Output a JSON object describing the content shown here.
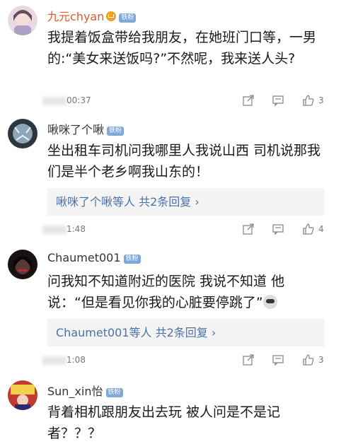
{
  "comments": [
    {
      "username": "九元chyan",
      "badge": "铁粉",
      "content": "我提着饭盒带给我朋友，在她班门口等，一男的:“美女来送饭吗?”不然呢，我来送人头?",
      "time": "00:37",
      "likes": "3"
    },
    {
      "username": "啾咪了个啾",
      "badge": "铁粉",
      "content": "坐出租车司机问我哪里人我说山西 司机说那我们是半个老乡啊我山东的！",
      "reply_summary": "啾咪了个啾等人  共2条回复 ›",
      "time": "1:48",
      "likes": "4"
    },
    {
      "username": "Chaumet001",
      "badge": "铁粉",
      "content": "问我知不知道附近的医院 我说不知道 他说：“但是看见你我的心脏要停跳了”",
      "reply_summary": "Chaumet001等人 共2条回复 ›",
      "time": "1:08",
      "likes": "3"
    },
    {
      "username": "Sun_xin怡",
      "badge": "铁粉",
      "content": "背着相机跟朋友出去玩 被人问是不是记者？？？"
    }
  ],
  "colors": {
    "badge": "#7fa9d8",
    "reply_link": "#4a72a8",
    "crown": "#f0a020"
  },
  "icons": [
    "share-icon",
    "comment-icon",
    "like-icon"
  ]
}
